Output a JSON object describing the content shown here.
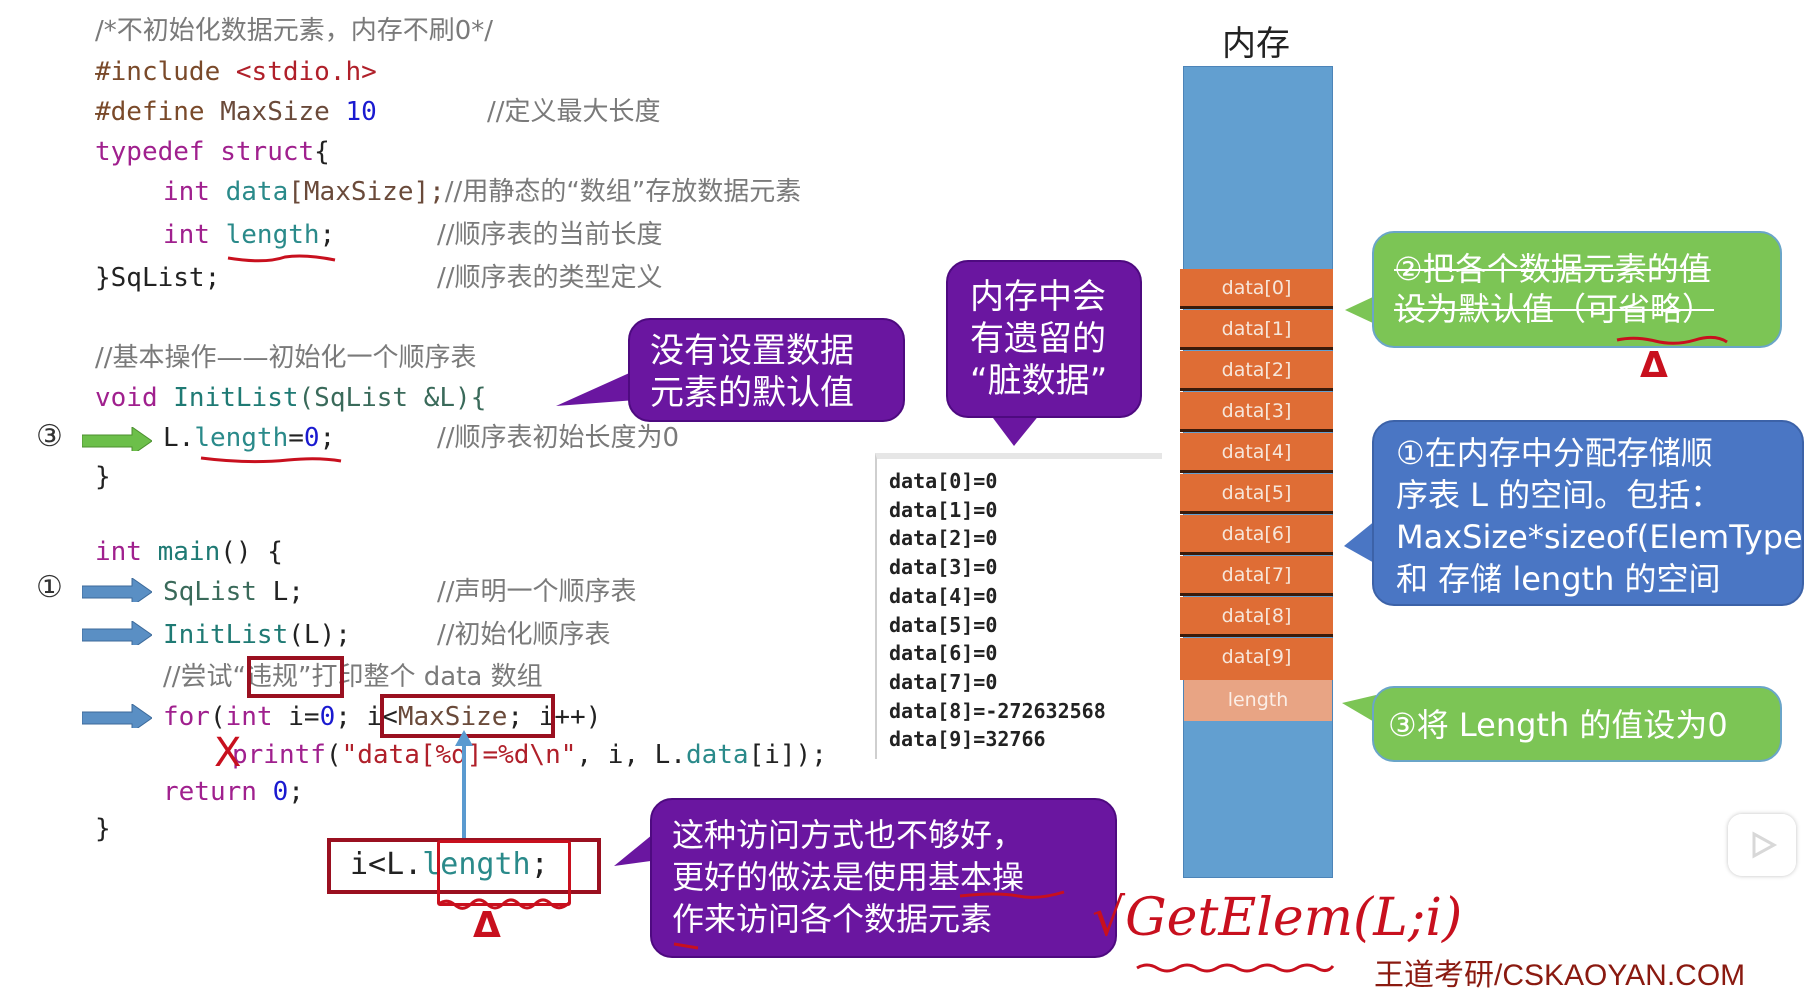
{
  "code": {
    "comment_header": "/*不初始化数据元素，内存不刷0*/",
    "include_kw": "#include",
    "include_file": "<stdio.h>",
    "define_kw": "#define",
    "define_name": "MaxSize",
    "define_value": "10",
    "define_comment": "//定义最大长度",
    "typedef_kw": "typedef",
    "struct_kw": "struct",
    "brace_open": "{",
    "int_kw": "int",
    "data_field": "data",
    "data_bracket": "[MaxSize];",
    "data_comment": "//用静态的“数组”存放数据元素",
    "length_field": "length",
    "semicolon": ";",
    "length_comment": "//顺序表的当前长度",
    "struct_close": "}SqList;",
    "struct_comment": "//顺序表的类型定义",
    "initlist_comment": "//基本操作——初始化一个顺序表",
    "void_kw": "void",
    "initlist_name": "InitList",
    "initlist_params": "(SqList &L){",
    "l_prefix": "L.",
    "length_assign": "length",
    "assign_eq": "=",
    "zero": "0",
    "assign_comment": "//顺序表初始长度为0",
    "brace_close": "}",
    "main_kw": "int",
    "main_name": "main",
    "main_rest": "() {",
    "decl_type": "SqList",
    "decl_rest": " L;",
    "decl_comment": "//声明一个顺序表",
    "call_name": "InitList",
    "call_rest": "(L);",
    "call_comment": "//初始化顺序表",
    "try_comment_a": "//尝试",
    "try_comment_b": "“违规”",
    "try_comment_c": "打印整个 data 数组",
    "for_kw": "for",
    "for_paren": "(",
    "for_int": "int",
    "for_init": " i=",
    "for_zero": "0",
    "for_semi": "; ",
    "for_cond_a": "i<",
    "for_cond_b": "MaxSize",
    "for_cond_c": ";",
    "for_inc": " i++)",
    "printf_name": "printf",
    "printf_open": "(",
    "printf_fmt": "\"data[%d]=%d\\n\"",
    "printf_args_a": ", i, L.",
    "printf_args_b": "data",
    "printf_args_c": "[i]);",
    "return_kw": "return",
    "return_val": "0",
    "main_close": "}",
    "alt_cond_a": "i<L.",
    "alt_cond_b": "length",
    "alt_cond_c": ";"
  },
  "markers": {
    "step3": "③",
    "step1": "①",
    "arrow_green": "#6cbf4a",
    "arrow_blue": "#5a8fc4"
  },
  "bubbles": {
    "no_default": "没有设置数据\n元素的默认值",
    "dirty_data": "内存中会\n有遗留的\n“脏数据”",
    "better_way": "这种访问方式也不够好，\n更好的做法是使用基本操\n作来访问各个数据元素",
    "step2": "②把各个数据元素的值\n设为默认值（可省略）",
    "step1": "①在内存中分配存储顺\n序表 L 的空间。包括：\nMaxSize*sizeof(ElemType)\n和 存储 length 的空间",
    "step3": "③将 Length 的值设为0"
  },
  "console": {
    "lines": [
      "data[0]=0",
      "data[1]=0",
      "data[2]=0",
      "data[3]=0",
      "data[4]=0",
      "data[5]=0",
      "data[6]=0",
      "data[7]=0",
      "data[8]=-272632568",
      "data[9]=32766"
    ]
  },
  "memory": {
    "title": "内存",
    "cells": [
      "data[0]",
      "data[1]",
      "data[2]",
      "data[3]",
      "data[4]",
      "data[5]",
      "data[6]",
      "data[7]",
      "data[8]",
      "data[9]"
    ],
    "length_cell": "length",
    "colors": {
      "free": "#629fd0",
      "data": "#df6d35",
      "length": "#e8a484"
    }
  },
  "annotations": {
    "getelem": "√GetElem(L;i)",
    "x_mark": "X",
    "triangle_mark": "Δ"
  },
  "watermark": "王道考研/CSKAOYAN.COM",
  "player": {
    "icon": "bilibili-tv-icon"
  }
}
